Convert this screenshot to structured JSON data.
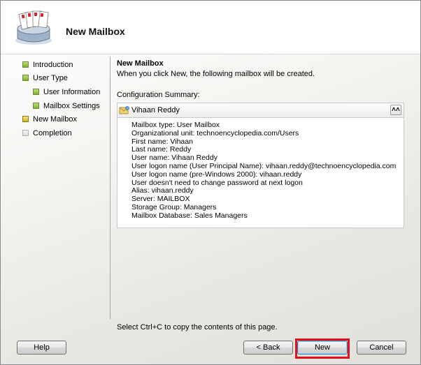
{
  "header": {
    "title": "New Mailbox"
  },
  "nav": {
    "items": [
      {
        "label": "Introduction",
        "state": "done"
      },
      {
        "label": "User Type",
        "state": "done"
      },
      {
        "label": "User Information",
        "state": "done",
        "indent": true
      },
      {
        "label": "Mailbox Settings",
        "state": "done",
        "indent": true
      },
      {
        "label": "New Mailbox",
        "state": "current"
      },
      {
        "label": "Completion",
        "state": "pending"
      }
    ]
  },
  "content": {
    "title": "New Mailbox",
    "description": "When you click New, the following mailbox will be created.",
    "summary_label": "Configuration Summary:",
    "summary": {
      "name": "Vihaan Reddy",
      "collapse_glyph": "˄˄",
      "lines": [
        "Mailbox type: User Mailbox",
        "Organizational unit: technoencyclopedia.com/Users",
        "First name: Vihaan",
        "Last name: Reddy",
        "User name: Vihaan Reddy",
        "User logon name (User Principal Name): vihaan.reddy@technoencyclopedia.com",
        "User logon name (pre-Windows 2000): vihaan.reddy",
        "User doesn't need to change password at next logon",
        "Alias: vihaan.reddy",
        "Server: MAILBOX",
        "Storage Group: Managers",
        "Mailbox Database: Sales Managers"
      ]
    },
    "hint": "Select Ctrl+C to copy the contents of this page."
  },
  "buttons": {
    "help": "Help",
    "back": "< Back",
    "new": "New",
    "cancel": "Cancel"
  },
  "colors": {
    "highlight": "#e0131c",
    "done": "#7fae2a",
    "current": "#d4b21e"
  }
}
